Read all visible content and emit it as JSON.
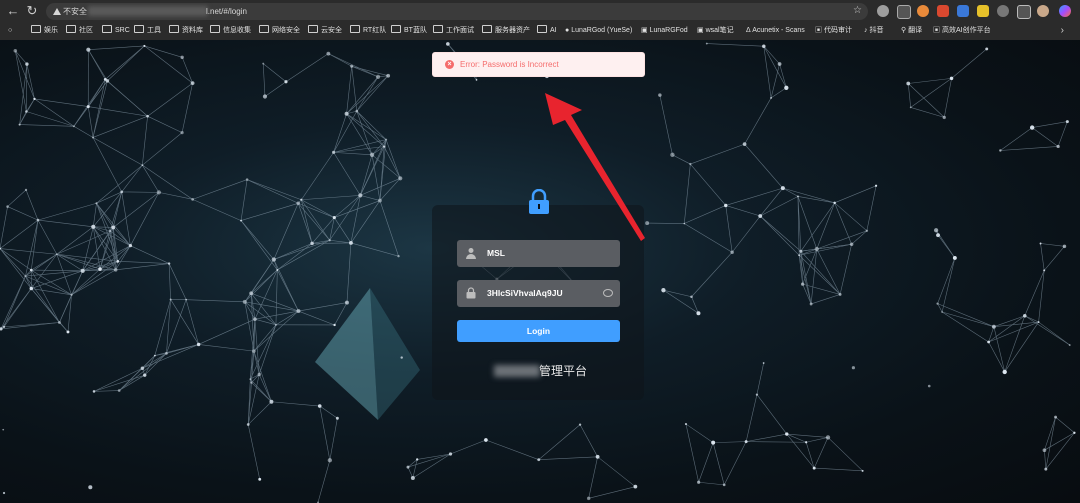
{
  "browser": {
    "insecure_label": "不安全",
    "url_suffix": "l.net/#/login",
    "bookmarks": [
      "娱乐",
      "社区",
      "SRC",
      "工具",
      "资料库",
      "信息收集",
      "网络安全",
      "云安全",
      "RT红队",
      "BT蓝队",
      "工作面试",
      "服务器资产",
      "AI",
      "LunaRGod (YueSe)",
      "LunaRGFod",
      "wsal笔记",
      "Acunetix - Scans",
      "代码审计",
      "抖音",
      "翻译",
      "高效AI创作平台"
    ]
  },
  "toast": {
    "message": "Error: Password is Incorrect",
    "color": "#f56c6c"
  },
  "login": {
    "username_value": "MSL",
    "password_value": "3HlcSiVhvalAq9JU",
    "submit_label": "Login",
    "title_suffix": "管理平台",
    "accent": "#409eff"
  }
}
